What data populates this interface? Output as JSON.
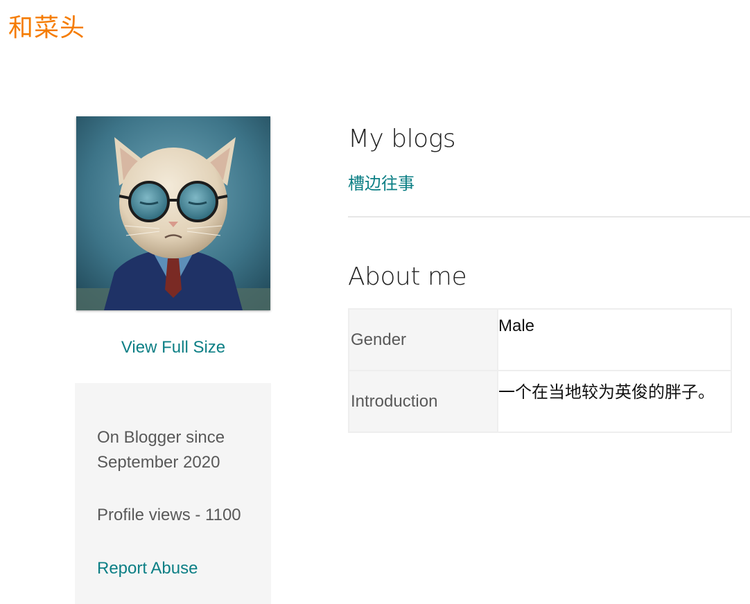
{
  "site": {
    "title": "和菜头"
  },
  "profile": {
    "avatar_icon": "profile-avatar-cat-in-suit",
    "view_full_size": "View Full Size",
    "since_line1": "On Blogger since",
    "since_line2": "September 2020",
    "profile_views": "Profile views - 1100",
    "report_abuse": "Report Abuse"
  },
  "blogs": {
    "heading": "My blogs",
    "items": [
      {
        "title": "槽边往事"
      }
    ]
  },
  "about": {
    "heading": "About me",
    "rows": [
      {
        "label": "Gender",
        "value": "Male"
      },
      {
        "label": "Introduction",
        "value": "一个在当地较为英俊的胖子。"
      }
    ]
  },
  "colors": {
    "title": "#f57c00",
    "link": "#0c7f85",
    "muted_text": "#595959",
    "panel_bg": "#f5f5f5"
  }
}
